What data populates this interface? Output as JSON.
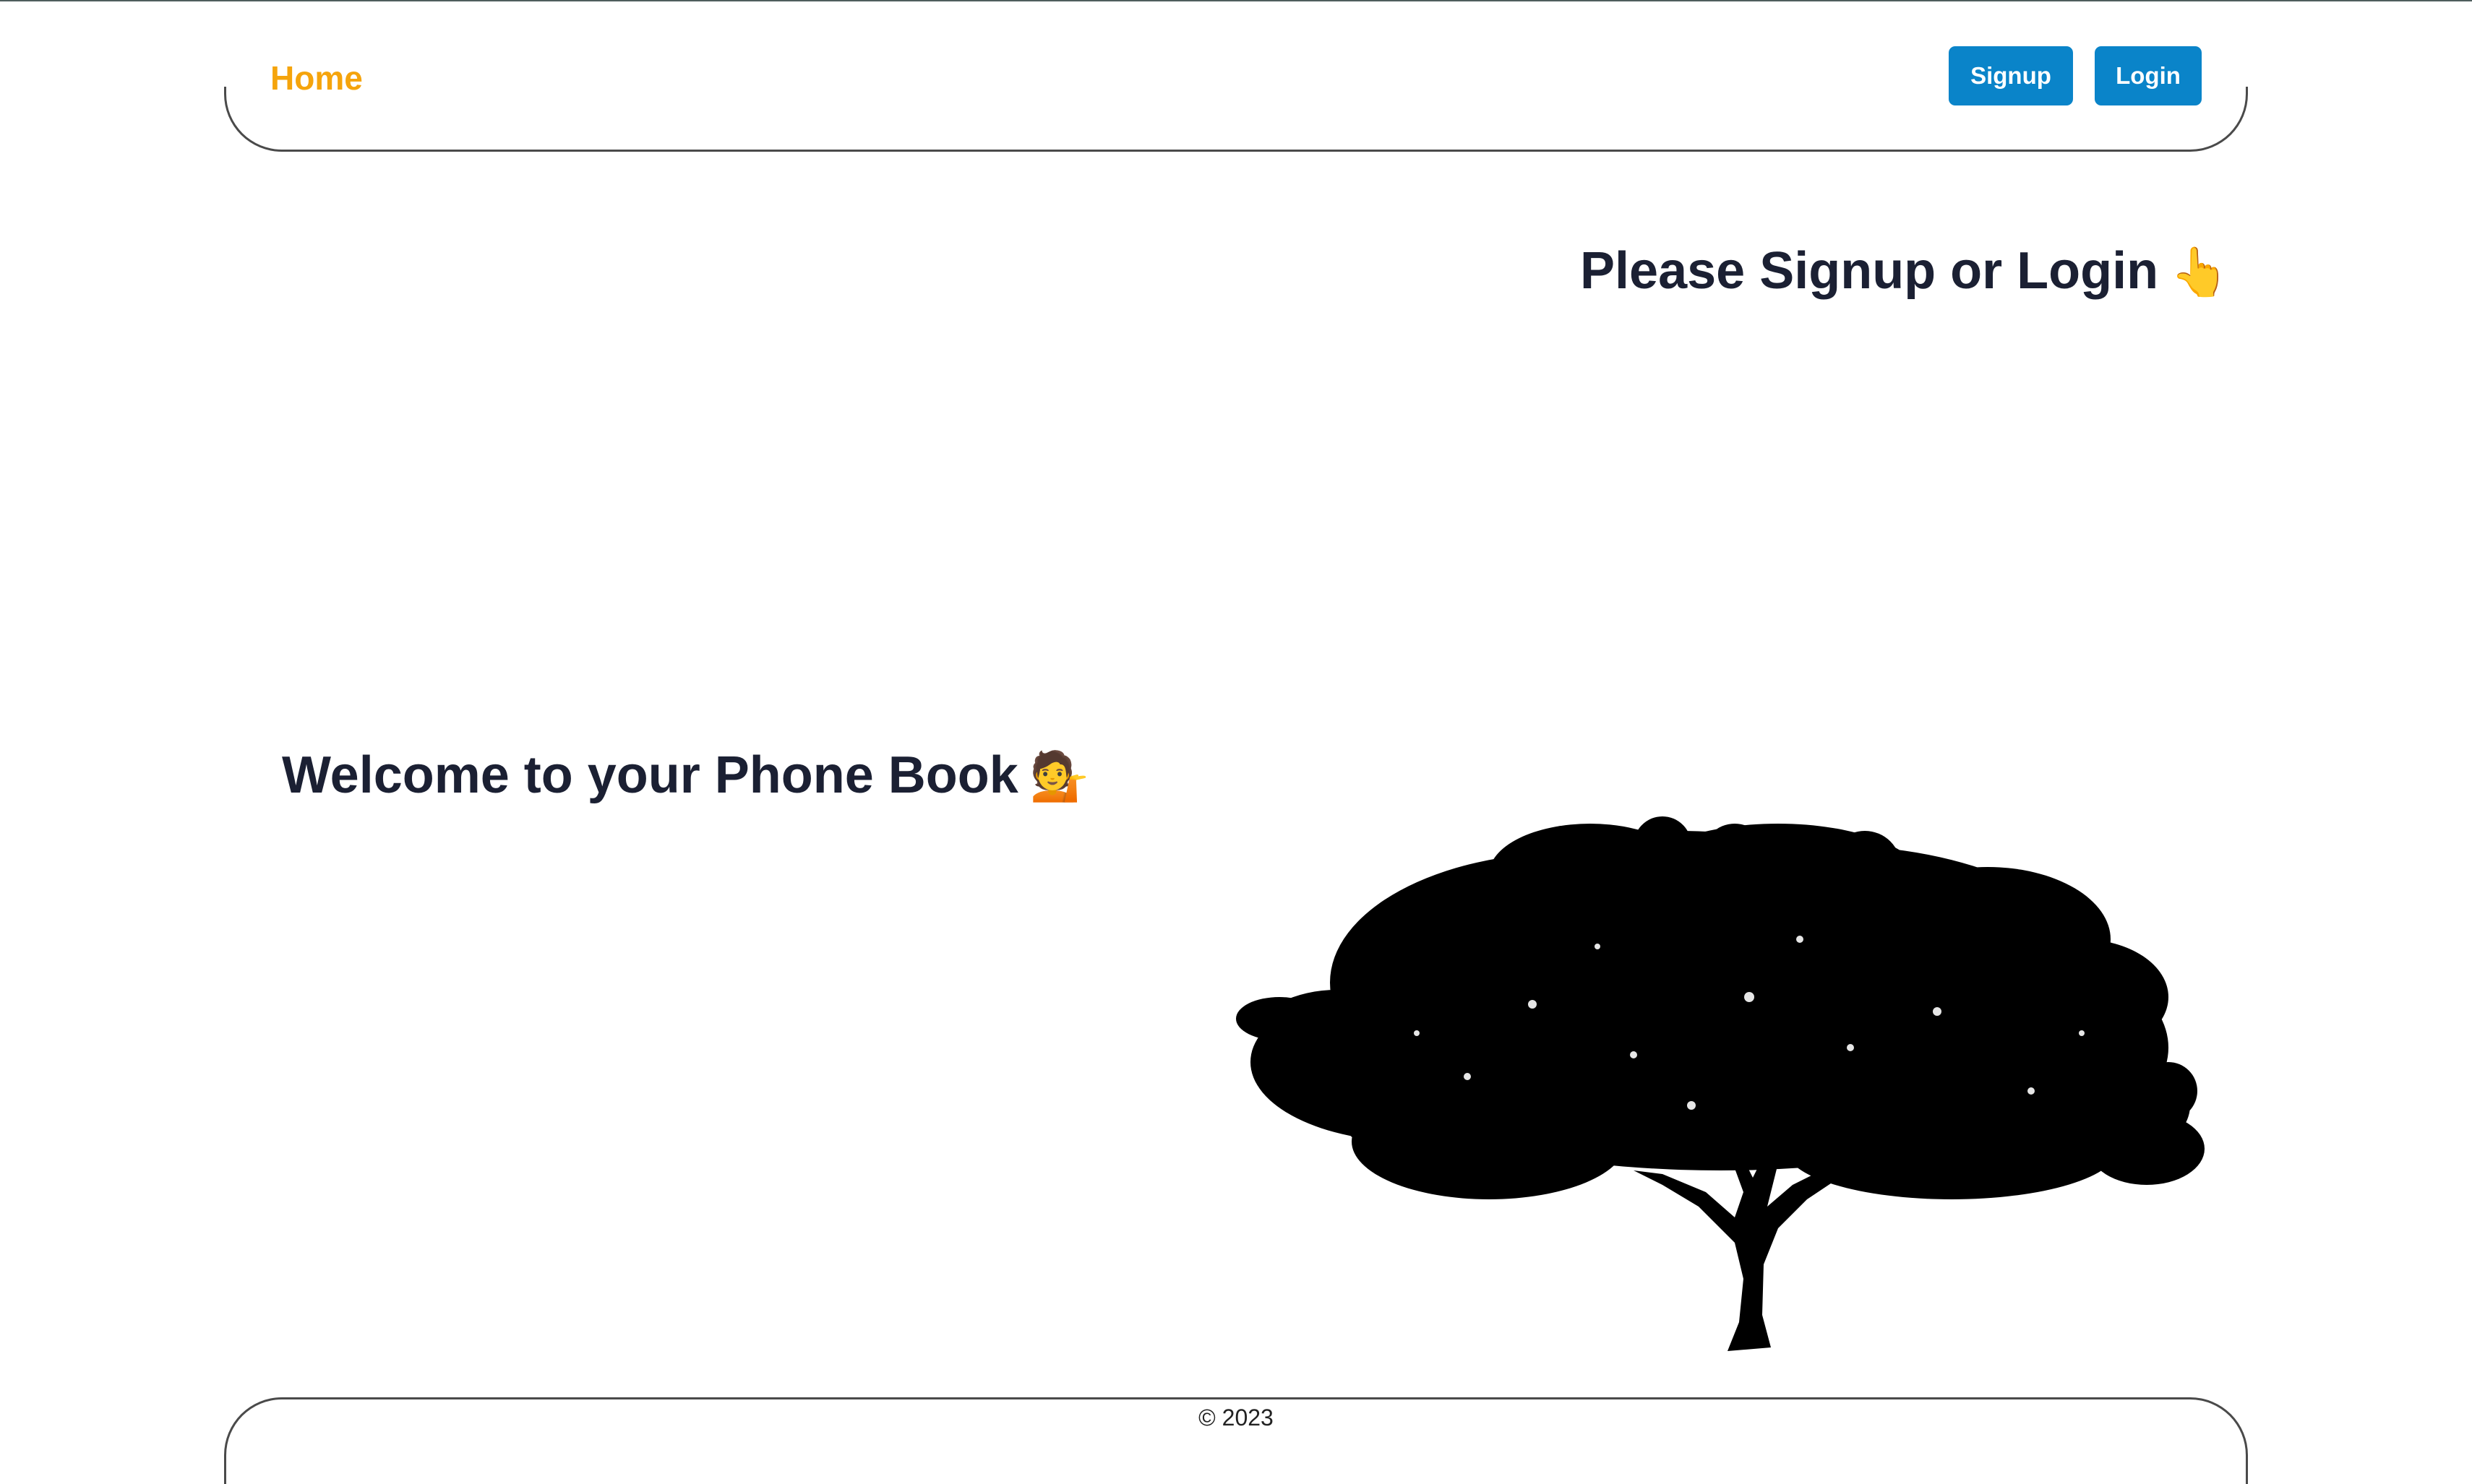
{
  "nav": {
    "home_label": "Home",
    "signup_label": "Signup",
    "login_label": "Login"
  },
  "main": {
    "prompt_heading": "Please Signup or Login",
    "prompt_emoji": "👆",
    "welcome_heading": "Welcome to your Phone Book",
    "welcome_emoji": "💁"
  },
  "footer": {
    "copyright": "© 2023"
  },
  "colors": {
    "brand_home": "#f5a40c",
    "button_bg": "#0a84c9",
    "heading_text": "#1b2033"
  },
  "icons": {
    "hero_image": "tree-silhouette"
  }
}
